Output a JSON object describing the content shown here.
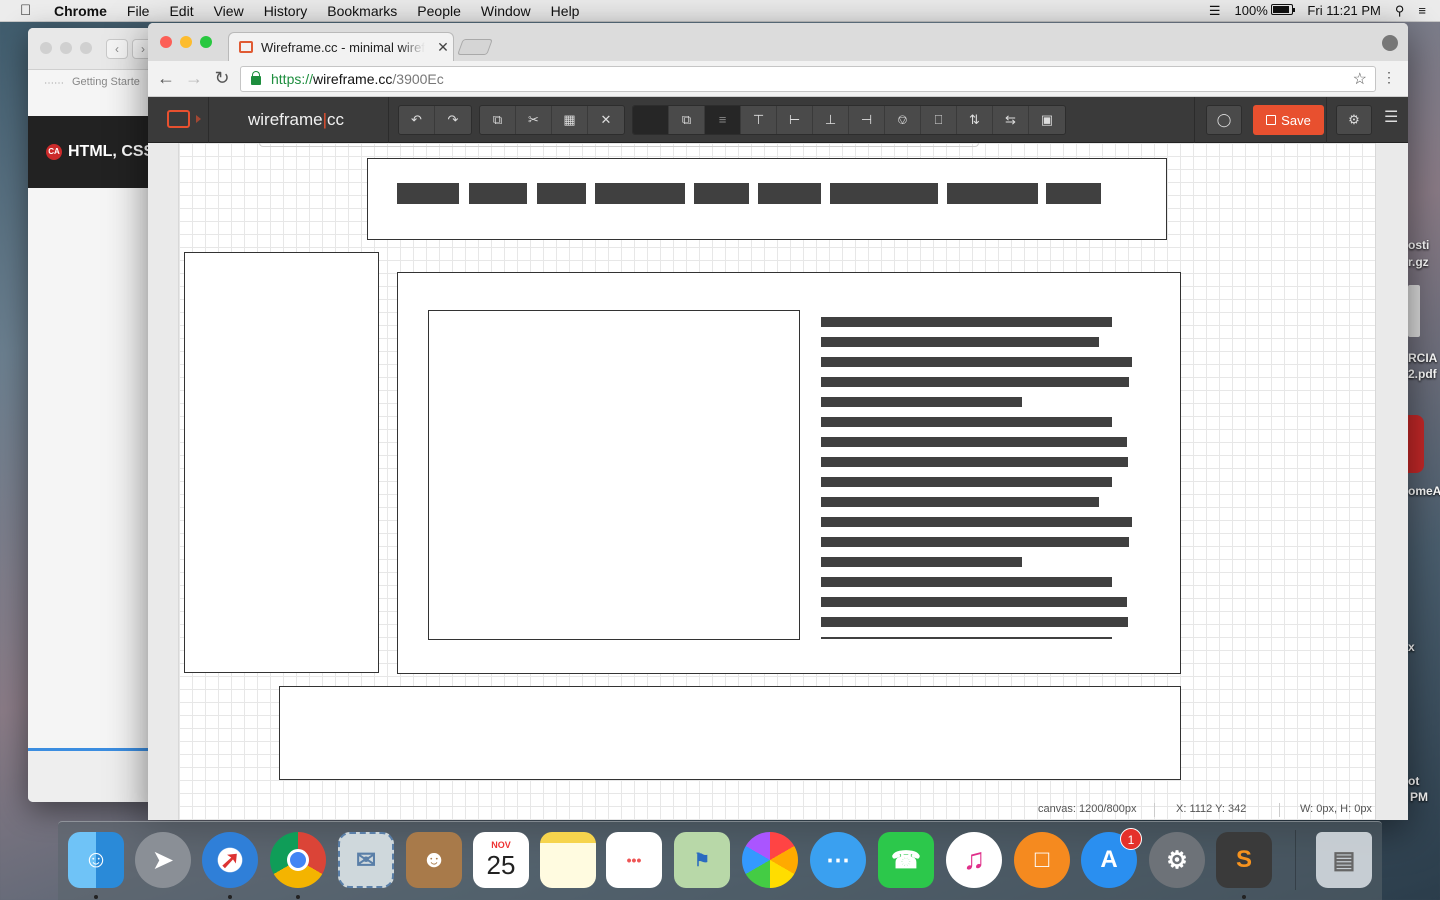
{
  "menubar": {
    "app_name": "Chrome",
    "items": [
      "File",
      "Edit",
      "View",
      "History",
      "Bookmarks",
      "People",
      "Window",
      "Help"
    ],
    "battery": "100%",
    "clock": "Fri 11:21 PM"
  },
  "desktop": {
    "labels": [
      "osti",
      "r.gz",
      "RCIA",
      "2.pdf",
      "omeA",
      "x",
      "ot",
      "PM"
    ]
  },
  "background_window": {
    "tab_text": "Getting Starte",
    "banner_text": "HTML, CSS",
    "banner_badge": "CA"
  },
  "browser": {
    "tab_title": "Wireframe.cc - minimal wireframing tool",
    "url_scheme": "https://",
    "url_host": "wireframe.cc",
    "url_path": "/3900Ec"
  },
  "app": {
    "brand_left": "wireframe",
    "brand_sep": "|",
    "brand_right": "cc",
    "save_label": "Save",
    "edit_tools": [
      "undo-icon",
      "redo-icon"
    ],
    "clip_tools": [
      "copy-icon",
      "cut-icon",
      "paste-icon",
      "delete-icon"
    ],
    "align_tools": [
      "fill-swatch",
      "arrange-icon",
      "align-left-edge-icon",
      "align-top-icon",
      "align-left-icon",
      "align-bottom-icon",
      "align-right-icon",
      "center-vertical-icon",
      "center-horizontal-icon",
      "distribute-vertical-icon",
      "distribute-horizontal-icon",
      "group-icon"
    ]
  },
  "status": {
    "canvas": "canvas: 1200/800px",
    "coords": "X: 1112 Y: 342",
    "size": "W: 0px, H: 0px"
  },
  "dock": {
    "apps": [
      "Finder",
      "Launchpad",
      "Safari",
      "Chrome",
      "Mail",
      "Contacts",
      "Calendar",
      "Notes",
      "Reminders",
      "Maps",
      "Photos",
      "Messages",
      "FaceTime",
      "iTunes",
      "iBooks",
      "App Store",
      "System Preferences",
      "Sublime Text",
      "Trash"
    ],
    "calendar_month": "NOV",
    "calendar_day": "25",
    "appstore_badge": "1"
  }
}
